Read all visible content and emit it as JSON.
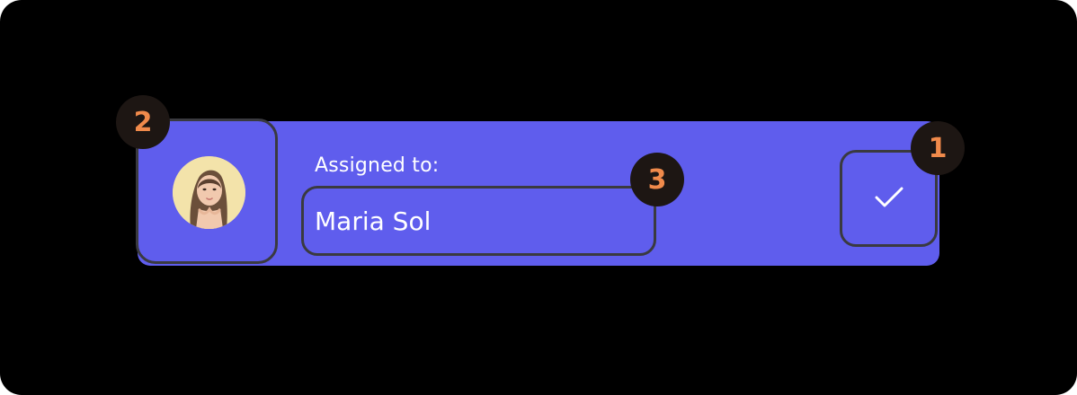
{
  "card": {
    "assigned_label": "Assigned to:",
    "assignee_name": "Maria Sol",
    "accent_color": "#5f5ded"
  },
  "confirm": {
    "icon": "check-icon"
  },
  "avatar": {
    "icon": "user-photo"
  },
  "markers": {
    "confirm": "1",
    "avatar": "2",
    "name_field": "3",
    "color": "#f08a4b"
  }
}
